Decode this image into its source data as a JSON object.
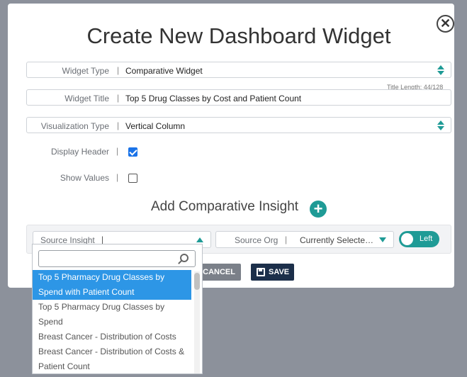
{
  "modal": {
    "title": "Create New Dashboard Widget",
    "close_symbol": "✕"
  },
  "form": {
    "widget_type": {
      "label": "Widget Type",
      "value": "Comparative Widget"
    },
    "widget_title": {
      "label": "Widget Title",
      "value": "Top 5 Drug Classes by Cost and Patient Count"
    },
    "title_length": "Title Length: 44/128",
    "visualization_type": {
      "label": "Visualization Type",
      "value": "Vertical Column"
    },
    "display_header": {
      "label": "Display Header",
      "checked": true
    },
    "show_values": {
      "label": "Show Values",
      "checked": false
    },
    "separator": "|"
  },
  "comparative": {
    "heading": "Add Comparative Insight",
    "add_symbol": "+",
    "source_insight_label": "Source Insight",
    "source_org_label": "Source Org",
    "source_org_value": "Currently Selecte…",
    "toggle_label": "Left",
    "toggle_color": "#1f9b96"
  },
  "buttons": {
    "cancel": "CANCEL",
    "save": "SAVE"
  },
  "dropdown": {
    "search_placeholder": "",
    "items": [
      "Top 5 Pharmacy Drug Classes by Spend with Patient Count",
      "Top 5 Pharmacy Drug Classes by Spend",
      "Breast Cancer - Distribution of Costs",
      "Breast Cancer - Distribution of Costs & Patient Count"
    ],
    "selected_index": 0,
    "highlight_color": "#2d96e6"
  },
  "icons": {
    "close": "close-icon",
    "add": "plus-circle-icon",
    "search": "search-icon",
    "save": "floppy-disk-icon"
  }
}
